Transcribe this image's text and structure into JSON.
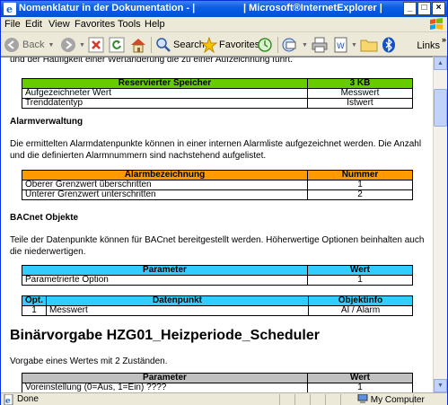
{
  "window": {
    "title_left": "Nomenklatur in der Dokumentation - |",
    "title_right": "| Microsoft®InternetExplorer |",
    "btn_min": "_",
    "btn_max": "□",
    "btn_close": "×"
  },
  "menu": {
    "items": [
      "File",
      "Edit",
      "View",
      "Favorites",
      "Tools",
      "Help"
    ]
  },
  "toolbar": {
    "back": "Back",
    "search": "Search",
    "favorites": "Favorites",
    "links": "Links",
    "more": "»"
  },
  "doc": {
    "top_text": "und der Häufigkeit einer Wertänderung die zu einer Aufzeichnung führt.",
    "speicher": {
      "header_left": "Reservierter Speicher",
      "header_right": "3 KB",
      "accent": "#66cc00",
      "rows": [
        [
          "Aufgezeichneter Wert",
          "Messwert"
        ],
        [
          "Trenddatentyp",
          "Istwert"
        ]
      ]
    },
    "alarm_heading": "Alarmverwaltung",
    "alarm_text": "Die ermittelten Alarmdatenpunkte können in einer internen Alarmliste aufgezeichnet werden. Die Anzahl und die definierten Alarmnummern sind nachstehend aufgelistet.",
    "alarm": {
      "header_left": "Alarmbezeichnung",
      "header_right": "Nummer",
      "accent": "#ff9900",
      "rows": [
        [
          "Oberer Grenzwert überschritten",
          "1"
        ],
        [
          "Unterer Grenzwert unterschritten",
          "2"
        ]
      ]
    },
    "bacnet_heading": "BACnet Objekte",
    "bacnet_text": "Teile der Datenpunkte können für BACnet bereitgestellt werden. Höherwertige Optionen beinhalten auch die niederwertigen.",
    "param": {
      "header_left": "Parameter",
      "header_right": "Wert",
      "accent": "#33ccff",
      "rows": [
        [
          "Parametrierte Option",
          "1"
        ]
      ]
    },
    "dp": {
      "header_opt": "Opt.",
      "header_dp": "Datenpunkt",
      "header_info": "Objektinfo",
      "accent": "#33ccff",
      "rows": [
        [
          "1",
          "Messwert",
          "AI / Alarm"
        ]
      ]
    },
    "binary_heading": "Binärvorgabe HZG01_Heizperiode_Scheduler",
    "binary_text": "Vorgabe eines Wertes mit 2 Zuständen.",
    "param2": {
      "header_left": "Parameter",
      "header_right": "Wert",
      "accent": "#c0c0c0",
      "rows": [
        [
          "Voreinstellung (0=Aus, 1=Ein) ????",
          "1"
        ]
      ]
    }
  },
  "status": {
    "done": "Done",
    "zone": "My Computer"
  }
}
